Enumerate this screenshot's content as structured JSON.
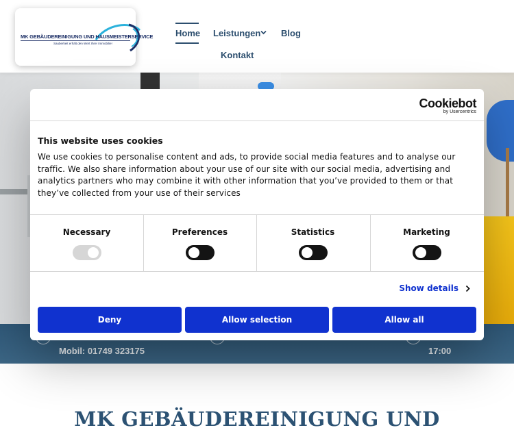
{
  "header": {
    "logo": {
      "title": "MK GEBÄUDEREINIGUNG UND HAUSMEISTERSERVICE",
      "tagline": "Sauberkeit erhält den Wert Ihrer Immobilie!"
    },
    "nav": {
      "home": "Home",
      "leistungen": "Leistungen",
      "blog": "Blog",
      "kontakt": "Kontakt"
    }
  },
  "infobar": {
    "phone": "Mobil: 01749 323175",
    "hours": "17:00"
  },
  "main": {
    "heading": "MK GEBÄUDEREINIGUNG UND"
  },
  "cookie_dialog": {
    "brand": "Cookiebot",
    "brand_sub": "by Usercentrics",
    "title": "This website uses cookies",
    "body": "We use cookies to personalise content and ads, to provide social media features and to analyse our traffic. We also share information about your use of our site with our social media, advertising and analytics partners who may combine it with other information that you’ve provided to them or that they’ve collected from your use of their services",
    "categories": [
      {
        "label": "Necessary",
        "enabled": true,
        "disabled": true
      },
      {
        "label": "Preferences",
        "enabled": false,
        "disabled": false
      },
      {
        "label": "Statistics",
        "enabled": false,
        "disabled": false
      },
      {
        "label": "Marketing",
        "enabled": false,
        "disabled": false
      }
    ],
    "show_details": "Show details",
    "buttons": {
      "deny": "Deny",
      "allow_selection": "Allow selection",
      "allow_all": "Allow all"
    },
    "accent_color": "#1032cf"
  }
}
